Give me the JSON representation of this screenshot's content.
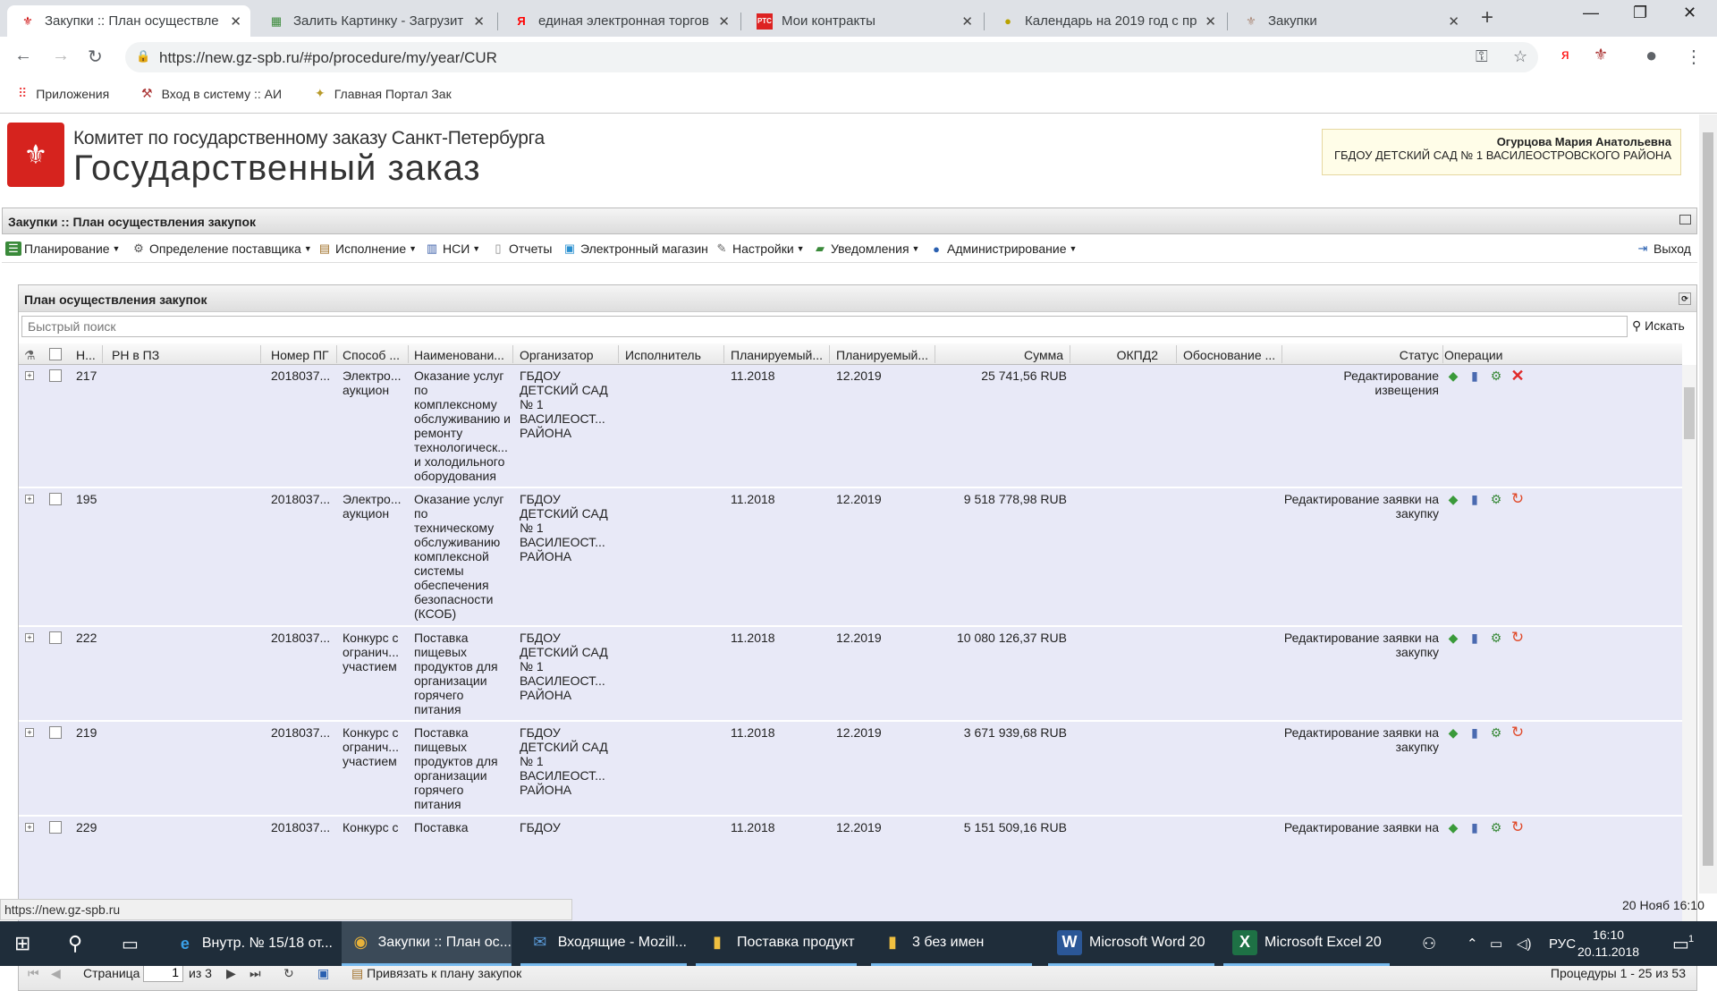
{
  "browser": {
    "tabs": [
      {
        "title": "Закупки :: План осуществле",
        "icon": "spb-emblem-icon",
        "active": true
      },
      {
        "title": "Залить Картинку - Загрузит",
        "icon": "image-host-icon",
        "active": false
      },
      {
        "title": "единая электронная торгов",
        "icon": "yandex-icon",
        "active": false
      },
      {
        "title": "Мои контракты",
        "icon": "rts-icon",
        "active": false
      },
      {
        "title": "Календарь на 2019 год с пр",
        "icon": "calendar-site-icon",
        "active": false
      },
      {
        "title": "Закупки",
        "icon": "emblem-icon",
        "active": false
      }
    ],
    "url": "https://new.gz-spb.ru/#po/procedure/my/year/CUR",
    "bookmarks": [
      {
        "label": "Приложения",
        "icon": "apps-grid-icon"
      },
      {
        "label": "Вход в систему :: АИ",
        "icon": "tools-icon"
      },
      {
        "label": "Главная Портал Зак",
        "icon": "eagle-emblem-icon"
      }
    ]
  },
  "header": {
    "org_line1": "Комитет по государственному заказу Санкт-Петербурга",
    "org_line2": "Государственный заказ",
    "user_name": "Огурцова Мария Анатольевна",
    "user_org": "ГБДОУ ДЕТСКИЙ САД № 1 ВАСИЛЕОСТРОВСКОГО РАЙОНА"
  },
  "page_title": "Закупки :: План осуществления закупок",
  "menu": [
    {
      "label": "Планирование",
      "dropdown": true,
      "icon": "planning-icon"
    },
    {
      "label": "Определение поставщика",
      "dropdown": true,
      "icon": "gear-icon"
    },
    {
      "label": "Исполнение",
      "dropdown": true,
      "icon": "execution-icon"
    },
    {
      "label": "НСИ",
      "dropdown": true,
      "icon": "reference-icon"
    },
    {
      "label": "Отчеты",
      "dropdown": false,
      "icon": "report-icon"
    },
    {
      "label": "Электронный магазин",
      "dropdown": false,
      "icon": "shop-icon"
    },
    {
      "label": "Настройки",
      "dropdown": true,
      "icon": "wrench-icon"
    },
    {
      "label": "Уведомления",
      "dropdown": true,
      "icon": "notification-icon"
    },
    {
      "label": "Администрирование",
      "dropdown": true,
      "icon": "admin-user-icon"
    }
  ],
  "exit_label": "Выход",
  "panel_title": "План осуществления закупок",
  "search": {
    "placeholder": "Быстрый поиск",
    "button": "Искать"
  },
  "columns": [
    "Н...",
    "РН в ПЗ",
    "Номер ПГ",
    "Способ ...",
    "Наименовани...",
    "Организатор",
    "Исполнитель",
    "Планируемый...",
    "Планируемый...",
    "Сумма",
    "ОКПД2",
    "Обоснование ...",
    "Статус",
    "Операции"
  ],
  "rows": [
    {
      "num": "217",
      "pg": "2018037...",
      "method": "Электро... аукцион",
      "name": "Оказание услуг по комплексному обслуживанию и ремонту технологическ... и холодильного оборудования",
      "org": "ГБДОУ ДЕТСКИЙ САД № 1 ВАСИЛЕОСТ... РАЙОНА",
      "plan1": "11.2018",
      "plan2": "12.2019",
      "sum": "25 741,56 RUB",
      "status": "Редактирование извещения",
      "last_op": "delete"
    },
    {
      "num": "195",
      "pg": "2018037...",
      "method": "Электро... аукцион",
      "name": "Оказание услуг по техническому обслуживанию комплексной системы обеспечения безопасности (КСОБ)",
      "org": "ГБДОУ ДЕТСКИЙ САД № 1 ВАСИЛЕОСТ... РАЙОНА",
      "plan1": "11.2018",
      "plan2": "12.2019",
      "sum": "9 518 778,98 RUB",
      "status": "Редактирование заявки на закупку",
      "last_op": "undo"
    },
    {
      "num": "222",
      "pg": "2018037...",
      "method": "Конкурс с огранич... участием",
      "name": "Поставка пищевых продуктов для организации горячего питания",
      "org": "ГБДОУ ДЕТСКИЙ САД № 1 ВАСИЛЕОСТ... РАЙОНА",
      "plan1": "11.2018",
      "plan2": "12.2019",
      "sum": "10 080 126,37 RUB",
      "status": "Редактирование заявки на закупку",
      "last_op": "undo"
    },
    {
      "num": "219",
      "pg": "2018037...",
      "method": "Конкурс с огранич... участием",
      "name": "Поставка пищевых продуктов для организации горячего питания",
      "org": "ГБДОУ ДЕТСКИЙ САД № 1 ВАСИЛЕОСТ... РАЙОНА",
      "plan1": "11.2018",
      "plan2": "12.2019",
      "sum": "3 671 939,68 RUB",
      "status": "Редактирование заявки на закупку",
      "last_op": "undo"
    },
    {
      "num": "229",
      "pg": "2018037...",
      "method": "Конкурс с",
      "name": "Поставка",
      "org": "ГБДОУ",
      "plan1": "11.2018",
      "plan2": "12.2019",
      "sum": "5 151 509,16 RUB",
      "status": "Редактирование заявки на",
      "last_op": "undo"
    }
  ],
  "pager": {
    "page_label": "Страница",
    "page": "1",
    "of": "из 3",
    "bind_label": "Привязать к плану закупок",
    "summary": "Процедуры 1 - 25 из 53"
  },
  "status_url": "https://new.gz-spb.ru",
  "status_date": "20 Нояб 16:10",
  "taskbar": {
    "items": [
      {
        "label": "Внутр. № 15/18 от...",
        "icon": "ie-icon"
      },
      {
        "label": "Закупки :: План ос...",
        "icon": "chrome-icon",
        "active": true
      },
      {
        "label": "Входящие - Mozill...",
        "icon": "thunderbird-icon"
      },
      {
        "label": "Поставка продукт",
        "icon": "folder-icon"
      },
      {
        "label": "3 без имен",
        "icon": "folder-icon"
      },
      {
        "label": "Microsoft Word 20",
        "icon": "word-icon"
      },
      {
        "label": "Microsoft Excel 20",
        "icon": "excel-icon"
      }
    ],
    "lang": "РУС",
    "time": "16:10",
    "date": "20.11.2018",
    "notif_count": "1"
  }
}
